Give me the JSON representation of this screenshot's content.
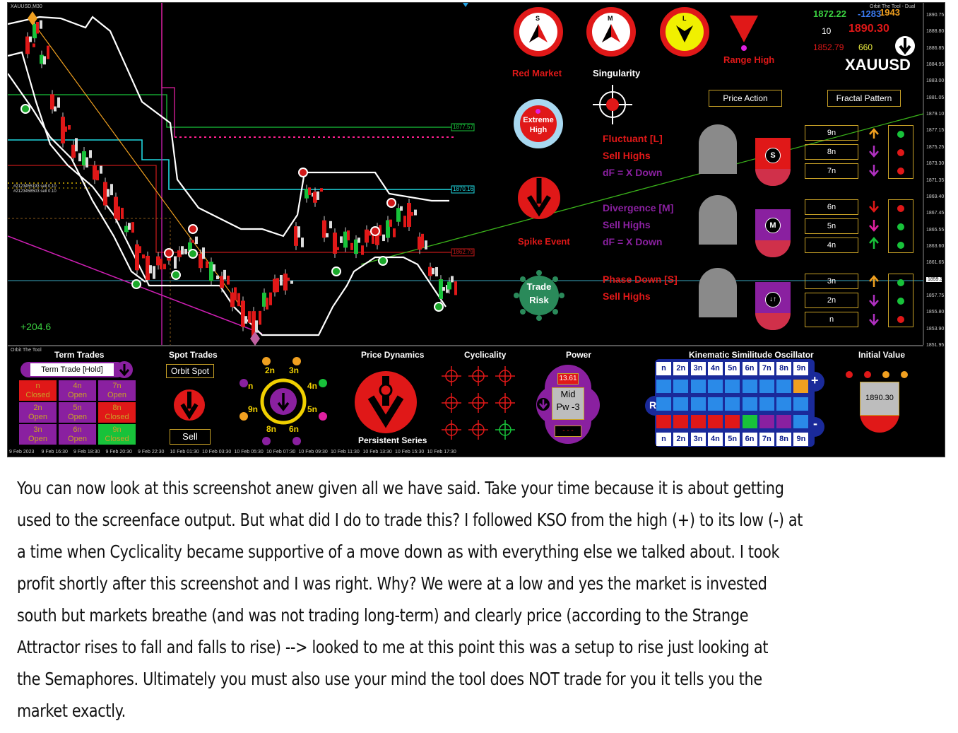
{
  "chart": {
    "symbol_tf": "XAUUSD,M30",
    "profit": "+204.6",
    "price_labels": [
      "1890.75",
      "1888.80",
      "1886.85",
      "1884.95",
      "1883.00",
      "1881.05",
      "1879.10",
      "1877.15",
      "1875.25",
      "1873.30",
      "1871.35",
      "1869.40",
      "1867.45",
      "1865.55",
      "1863.60",
      "1861.65",
      "1859.39",
      "1857.75",
      "1855.80",
      "1853.90",
      "1851.95"
    ],
    "level_tags": [
      "1877.57",
      "1870.16",
      "1862.79"
    ],
    "time_labels": [
      "9 Feb 2023",
      "9 Feb 16:30",
      "9 Feb 18:30",
      "9 Feb 20:30",
      "9 Feb 22:30",
      "10 Feb 01:30",
      "10 Feb 03:30",
      "10 Feb 05:30",
      "10 Feb 07:30",
      "10 Feb 09:30",
      "10 Feb 11:30",
      "10 Feb 13:30",
      "10 Feb 15:30",
      "10 Feb 17:30"
    ],
    "side_note": "#2123455193 sell 0.10\n#2123458503 sell 0.10"
  },
  "header": {
    "title": "Orbit The Tool - Dual",
    "v1": "1872.22",
    "v2": "-1283",
    "v3": "1943",
    "v4": "10",
    "v5": "1890.30",
    "v6": "1852.79",
    "v7": "660",
    "symbol": "XAUUSD"
  },
  "semaphores": {
    "s_letter": "S",
    "m_letter": "M",
    "l_letter": "L",
    "red_market": "Red Market",
    "singularity": "Singularity",
    "range_high": "Range High",
    "extreme_high": "Extreme High",
    "spike_event": "Spike Event",
    "trade_risk": "Trade Risk"
  },
  "buttons": {
    "price_action": "Price Action",
    "fractal_pattern": "Fractal Pattern"
  },
  "fractal": {
    "l_title": "Fluctuant [L]",
    "l_sub": "Sell Highs",
    "l_df": "dF = X Down",
    "m_title": "Divergence [M]",
    "m_sub": "Sell Highs",
    "m_df": "dF = X Down",
    "s_title": "Phase Down [S]",
    "s_sub": "Sell Highs",
    "s_badge": "S",
    "m_badge": "M",
    "levels": [
      "9n",
      "8n",
      "7n",
      "6n",
      "5n",
      "4n",
      "3n",
      "2n",
      "n"
    ]
  },
  "bottom": {
    "label": "Orbit The Tool",
    "term_trades": "Term Trades",
    "term_trade_hold": "Term Trade [Hold]",
    "cells": [
      [
        "n Closed",
        "4n Open",
        "7n Open"
      ],
      [
        "2n Open",
        "5n Open",
        "8n Closed"
      ],
      [
        "3n Open",
        "6n Open",
        "9n Closed"
      ]
    ],
    "spot_trades": "Spot Trades",
    "orbit_spot": "Orbit Spot",
    "sell": "Sell",
    "orbit_labels": [
      "2n",
      "3n",
      "4n",
      "5n",
      "6n",
      "8n",
      "9n",
      "n"
    ],
    "price_dynamics": "Price Dynamics",
    "persistent_series": "Persistent Series",
    "cyclicality": "Cyclicality",
    "power": "Power",
    "power_value": "13.61",
    "power_mid": "Mid",
    "power_pw": "Pw -3",
    "power_dashes": "- - -",
    "kso_title": "Kinematic Similitude Oscillator",
    "kso_labels": [
      "n",
      "2n",
      "3n",
      "4n",
      "5n",
      "6n",
      "7n",
      "8n",
      "9n"
    ],
    "kso_r": "R",
    "kso_plus": "+",
    "kso_minus": "-",
    "initial_value": "Initial Value",
    "initial_number": "1890.30"
  },
  "caption": [
    "You can now look at this screenshot anew given all we have said. Take your time because it is about getting",
    "used to the screenface output. But what did I do to trade this? I followed KSO from the high (+) to its low (-) at",
    "a time when Cyclicality became supportive of a move down as with everything else we talked about. I took",
    "profit shortly after this screenshot and I was right. Why? We were at a low and yes the market is invested",
    "south but markets breathe (and was not trading long-term) and clearly price (according to the Strange",
    "Attractor rises to fall and falls to rise) --> looked to me at this point this was a setup to rise just looking at",
    "the Semaphores. Ultimately you must also use your mind the tool does NOT trade for you it tells you the",
    "market exactly."
  ]
}
